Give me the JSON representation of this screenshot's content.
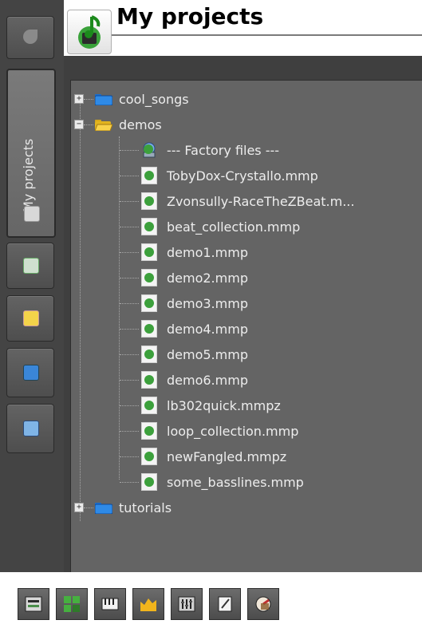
{
  "header": {
    "title": "My projects"
  },
  "sidebar": {
    "tabs": [
      {
        "icon": "speaker-icon"
      },
      {
        "label": "My projects",
        "icon": "project-icon",
        "active": true
      },
      {
        "icon": "instrument-plugin-icon"
      },
      {
        "icon": "star-icon"
      },
      {
        "icon": "home-icon"
      },
      {
        "icon": "computer-icon"
      }
    ]
  },
  "tree": {
    "items": [
      {
        "label": "cool_songs",
        "type": "folder",
        "expanded": false
      },
      {
        "label": "demos",
        "type": "folder",
        "expanded": true
      },
      {
        "label": "--- Factory files ---",
        "type": "file"
      },
      {
        "label": "TobyDox-Crystallo.mmp",
        "type": "file"
      },
      {
        "label": "Zvonsully-RaceTheZBeat.m...",
        "type": "file"
      },
      {
        "label": "beat_collection.mmp",
        "type": "file"
      },
      {
        "label": "demo1.mmp",
        "type": "file"
      },
      {
        "label": "demo2.mmp",
        "type": "file"
      },
      {
        "label": "demo3.mmp",
        "type": "file"
      },
      {
        "label": "demo4.mmp",
        "type": "file"
      },
      {
        "label": "demo5.mmp",
        "type": "file"
      },
      {
        "label": "demo6.mmp",
        "type": "file"
      },
      {
        "label": "lb302quick.mmpz",
        "type": "file"
      },
      {
        "label": "loop_collection.mmp",
        "type": "file"
      },
      {
        "label": "newFangled.mmpz",
        "type": "file"
      },
      {
        "label": "some_basslines.mmp",
        "type": "file"
      },
      {
        "label": "tutorials",
        "type": "folder",
        "expanded": false
      }
    ]
  },
  "toolbar": {
    "buttons": [
      {
        "icon": "song-editor-icon"
      },
      {
        "icon": "beat-bassline-editor-icon"
      },
      {
        "icon": "piano-roll-icon"
      },
      {
        "icon": "automation-editor-icon"
      },
      {
        "icon": "fx-mixer-icon"
      },
      {
        "icon": "project-notes-icon"
      },
      {
        "icon": "controller-rack-icon"
      }
    ]
  }
}
